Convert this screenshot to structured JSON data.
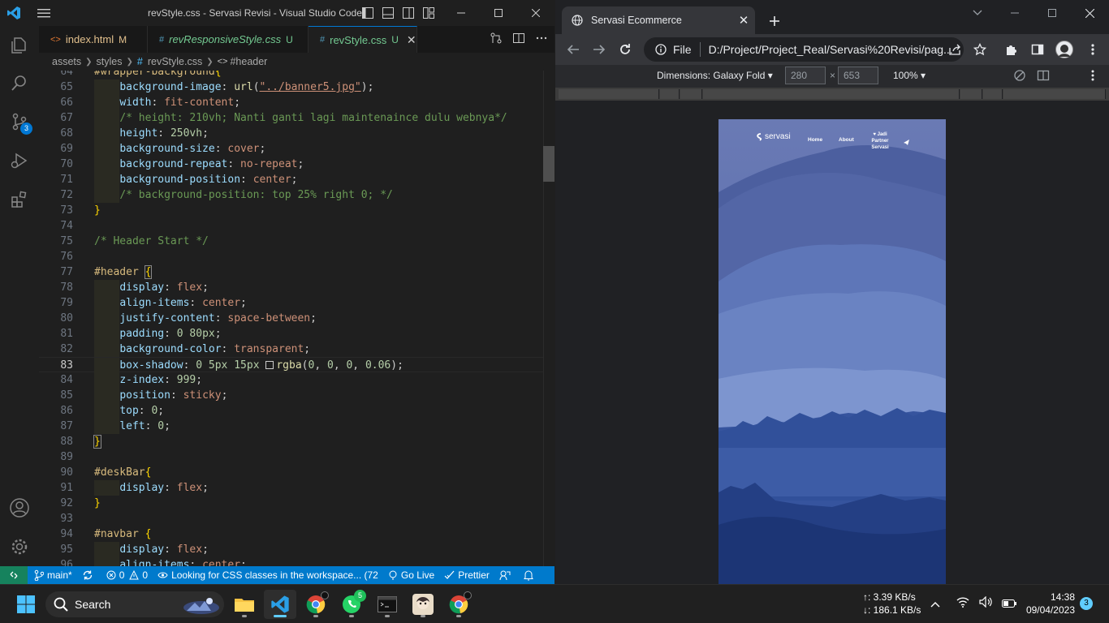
{
  "vscode": {
    "title": "revStyle.css - Servasi Revisi - Visual Studio Code",
    "scm_badge": "3",
    "tabs": [
      {
        "icon": "<>",
        "label": "index.html",
        "status": "M"
      },
      {
        "icon": "#",
        "label": "revResponsiveStyle.css",
        "status": "U"
      },
      {
        "icon": "#",
        "label": "revStyle.css",
        "status": "U"
      }
    ],
    "breadcrumb": [
      "assets",
      "styles",
      "revStyle.css",
      "#header"
    ],
    "code": [
      {
        "n": "64",
        "html": "<span class='tk-sel'>#wrapper-background</span><span class='tk-brace'>{</span>"
      },
      {
        "n": "65",
        "html": "    <span class='tk-prop'>background-image</span><span class='tk-pun'>: </span><span class='tk-fn'>url</span><span class='tk-pun'>(</span><span class='tk-str' style='text-decoration:underline'>\"../banner5.jpg\"</span><span class='tk-pun'>);</span>"
      },
      {
        "n": "66",
        "html": "    <span class='tk-prop'>width</span><span class='tk-pun'>: </span><span class='tk-val'>fit-content</span><span class='tk-pun'>;</span>"
      },
      {
        "n": "67",
        "html": "    <span class='tk-com'>/* height: 210vh; Nanti ganti lagi maintenaince dulu webnya*/</span>"
      },
      {
        "n": "68",
        "html": "    <span class='tk-prop'>height</span><span class='tk-pun'>: </span><span class='tk-num'>250vh</span><span class='tk-pun'>;</span>"
      },
      {
        "n": "69",
        "html": "    <span class='tk-prop'>background-size</span><span class='tk-pun'>: </span><span class='tk-val'>cover</span><span class='tk-pun'>;</span>"
      },
      {
        "n": "70",
        "html": "    <span class='tk-prop'>background-repeat</span><span class='tk-pun'>: </span><span class='tk-val'>no-repeat</span><span class='tk-pun'>;</span>"
      },
      {
        "n": "71",
        "html": "    <span class='tk-prop'>background-position</span><span class='tk-pun'>: </span><span class='tk-val'>center</span><span class='tk-pun'>;</span>"
      },
      {
        "n": "72",
        "html": "    <span class='tk-com'>/* background-position: top 25% right 0; */</span>"
      },
      {
        "n": "73",
        "html": "<span class='tk-brace'>}</span>"
      },
      {
        "n": "74",
        "html": ""
      },
      {
        "n": "75",
        "html": "<span class='tk-com'>/* Header Start */</span>"
      },
      {
        "n": "76",
        "html": ""
      },
      {
        "n": "77",
        "html": "<span class='tk-sel'>#header</span> <span class='tk-brace' style='outline:1px solid #888'>{</span>"
      },
      {
        "n": "78",
        "html": "    <span class='tk-prop'>display</span><span class='tk-pun'>: </span><span class='tk-val'>flex</span><span class='tk-pun'>;</span>"
      },
      {
        "n": "79",
        "html": "    <span class='tk-prop'>align-items</span><span class='tk-pun'>: </span><span class='tk-val'>center</span><span class='tk-pun'>;</span>"
      },
      {
        "n": "80",
        "html": "    <span class='tk-prop'>justify-content</span><span class='tk-pun'>: </span><span class='tk-val'>space-between</span><span class='tk-pun'>;</span>"
      },
      {
        "n": "81",
        "html": "    <span class='tk-prop'>padding</span><span class='tk-pun'>: </span><span class='tk-num'>0</span> <span class='tk-num'>80px</span><span class='tk-pun'>;</span>"
      },
      {
        "n": "82",
        "html": "    <span class='tk-prop'>background-color</span><span class='tk-pun'>: </span><span class='tk-val'>transparent</span><span class='tk-pun'>;</span>"
      },
      {
        "n": "83",
        "html": "    <span class='tk-prop'>box-shadow</span><span class='tk-pun'>: </span><span class='tk-num'>0</span> <span class='tk-num'>5px</span> <span class='tk-num'>15px</span> <span class='color-box'></span><span class='tk-fn'>rgba</span><span class='tk-pun'>(</span><span class='tk-num'>0</span><span class='tk-pun'>, </span><span class='tk-num'>0</span><span class='tk-pun'>, </span><span class='tk-num'>0</span><span class='tk-pun'>, </span><span class='tk-num'>0.06</span><span class='tk-pun'>);</span>"
      },
      {
        "n": "84",
        "html": "    <span class='tk-prop'>z-index</span><span class='tk-pun'>: </span><span class='tk-num'>999</span><span class='tk-pun'>;</span>"
      },
      {
        "n": "85",
        "html": "    <span class='tk-prop'>position</span><span class='tk-pun'>: </span><span class='tk-val'>sticky</span><span class='tk-pun'>;</span>"
      },
      {
        "n": "86",
        "html": "    <span class='tk-prop'>top</span><span class='tk-pun'>: </span><span class='tk-num'>0</span><span class='tk-pun'>;</span>"
      },
      {
        "n": "87",
        "html": "    <span class='tk-prop'>left</span><span class='tk-pun'>: </span><span class='tk-num'>0</span><span class='tk-pun'>;</span>"
      },
      {
        "n": "88",
        "html": "<span class='tk-brace' style='outline:1px solid #888'>}</span>"
      },
      {
        "n": "89",
        "html": ""
      },
      {
        "n": "90",
        "html": "<span class='tk-sel'>#deskBar</span><span class='tk-brace'>{</span>"
      },
      {
        "n": "91",
        "html": "    <span class='tk-prop'>display</span><span class='tk-pun'>: </span><span class='tk-val'>flex</span><span class='tk-pun'>;</span>"
      },
      {
        "n": "92",
        "html": "<span class='tk-brace'>}</span>"
      },
      {
        "n": "93",
        "html": ""
      },
      {
        "n": "94",
        "html": "<span class='tk-sel'>#navbar</span> <span class='tk-brace'>{</span>"
      },
      {
        "n": "95",
        "html": "    <span class='tk-prop'>display</span><span class='tk-pun'>: </span><span class='tk-val'>flex</span><span class='tk-pun'>;</span>"
      },
      {
        "n": "96",
        "html": "    <span class='tk-prop'>align-items</span><span class='tk-pun'>: </span><span class='tk-val'>center</span><span class='tk-pun'>;</span>"
      }
    ],
    "current_line": "83",
    "status": {
      "branch": "main*",
      "errors": "0",
      "warnings": "0",
      "message": "Looking for CSS classes in the workspace... (72",
      "golive": "Go Live",
      "prettier": "Prettier"
    }
  },
  "chrome": {
    "tab_title": "Servasi Ecommerce",
    "scheme_label": "File",
    "url": "D:/Project/Project_Real/Servasi%20Revisi/pag...",
    "devtools": {
      "dimensions_label": "Dimensions: Galaxy Fold",
      "width": "280",
      "height": "653",
      "times": "×",
      "zoom": "100%"
    },
    "site": {
      "logo": "servasi",
      "nav_home": "Home",
      "nav_about": "About",
      "nav_partner": "Jadi Partner Servasi"
    }
  },
  "taskbar": {
    "search_label": "Search",
    "whatsapp_badge": "5",
    "upload_speed": "↑: 3.39 KB/s",
    "download_speed": "↓: 186.1 KB/s",
    "time": "14:38",
    "date": "09/04/2023",
    "notification_count": "3"
  }
}
